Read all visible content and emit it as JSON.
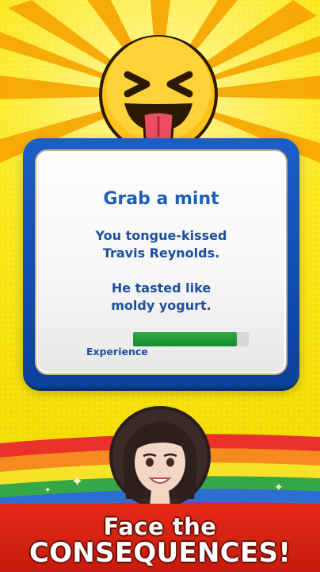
{
  "dialog": {
    "title": "Grab a mint",
    "line1": "You tongue-kissed",
    "line2": "Travis Reynolds.",
    "line3": "He tasted like",
    "line4": "moldy yogurt.",
    "xp_label": "Experience",
    "xp_progress": 0.9
  },
  "cta": {
    "line1": "Face the",
    "line2": "CONSEQUENCES!"
  },
  "colors": {
    "background": "#f6e400",
    "dialog_border": "#1c5ec9",
    "title_text": "#1c5fb5",
    "xp_fill": "#1f9a3a",
    "banner": "#e52a16"
  },
  "icons": {
    "reaction": "tongue-out-squint-emoji",
    "character": "female-avatar"
  }
}
